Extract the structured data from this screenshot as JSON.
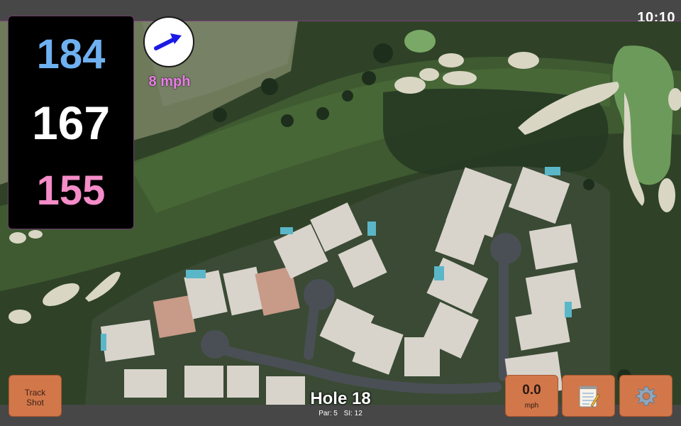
{
  "status": {
    "time": "10:10"
  },
  "distances": {
    "back": "184",
    "middle": "167",
    "front": "155",
    "colors": {
      "back": "#6fb0f0",
      "middle": "#ffffff",
      "front": "#f48cc8"
    }
  },
  "wind": {
    "label": "8 mph",
    "icon": "wind-direction-arrow-icon",
    "arrow_color": "#1a1ae6"
  },
  "buttons": {
    "track_shot": {
      "line1": "Track",
      "line2": "Shot"
    },
    "speed": {
      "value": "0.0",
      "unit": "mph"
    },
    "notes": {
      "icon": "notepad-icon"
    },
    "settings": {
      "icon": "gear-icon"
    }
  },
  "hole": {
    "title": "Hole 18",
    "par": "Par: 5",
    "si": "SI: 12"
  },
  "colors": {
    "button_bg": "#d2774a",
    "accent_purple": "#e97de9",
    "bar_bg": "#474747"
  }
}
